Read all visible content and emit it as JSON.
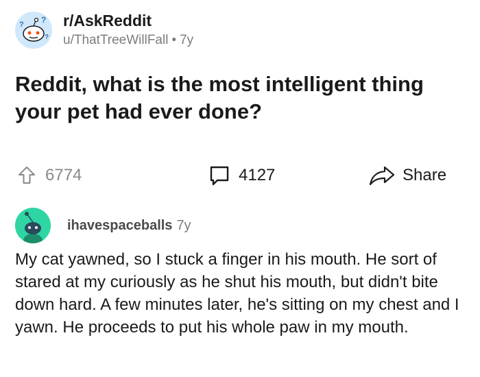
{
  "post": {
    "subreddit": "r/AskReddit",
    "author": "u/ThatTreeWillFall",
    "separator": "•",
    "age": "7y",
    "title": "Reddit, what is the most intelligent thing your pet had ever done?",
    "upvotes": "6774",
    "comments": "4127",
    "share_label": "Share"
  },
  "comment": {
    "author": "ihavespaceballs",
    "age": "7y",
    "body": "My cat yawned, so I stuck a finger in his mouth. He sort of stared at my curiously as he shut his mouth, but didn't bite down hard. A few minutes later, he's sitting on my chest and I yawn. He proceeds to put his whole paw in my mouth."
  },
  "icons": {
    "subreddit_avatar": "askreddit-snoo-icon",
    "upvote": "upvote-arrow-icon",
    "comments": "comment-bubble-icon",
    "share": "share-arrow-icon",
    "user_avatar": "user-snoo-avatar-icon"
  },
  "colors": {
    "text": "#1a1a1b",
    "meta": "#7c7c7c",
    "upvote_gray": "#878a8c",
    "user_avatar_bg": "#2fd6a3",
    "sub_avatar_bg": "#cfe8fb"
  }
}
